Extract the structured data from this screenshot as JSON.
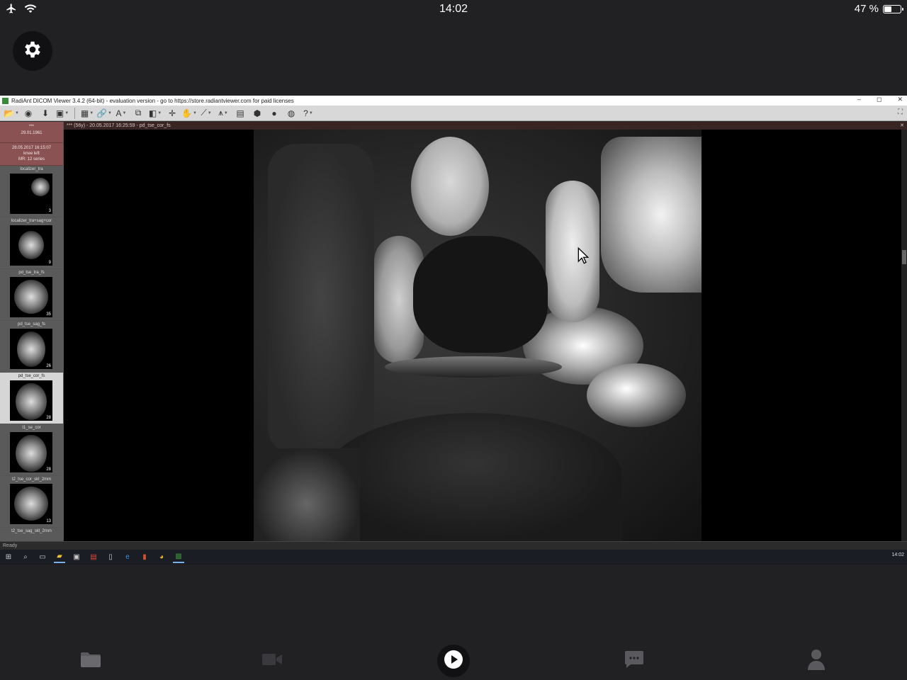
{
  "statusbar": {
    "time": "14:02",
    "battery_text": "47 %",
    "battery_level_percent": 47,
    "icons": [
      "airplane-icon",
      "wifi-icon",
      "battery-icon"
    ]
  },
  "settings": {
    "icon": "gear-icon"
  },
  "dicom": {
    "window_title": "RadiAnt DICOM Viewer 3.4.2 (64-bit) - evaluation version - go to https://store.radiantviewer.com for paid licenses",
    "window_controls": {
      "minimize": "–",
      "maximize": "◻",
      "close": "✕"
    },
    "patient": {
      "name": "***",
      "dob": "29.01.1961"
    },
    "study": {
      "datetime": "28.05.2017 16:15:07",
      "desc": "knee left",
      "summary": "MR: 12 series"
    },
    "series": [
      {
        "name": "localizer_tra",
        "count": "3"
      },
      {
        "name": "localizer_tra+sag+cor",
        "count": "9"
      },
      {
        "name": "pd_tse_tra_fs",
        "count": "35"
      },
      {
        "name": "pd_tse_sag_fs",
        "count": "26"
      },
      {
        "name": "pd_tse_cor_fs",
        "count": "28"
      },
      {
        "name": "t1_se_cor",
        "count": "28"
      },
      {
        "name": "t2_tse_cor_skl_2mm",
        "count": "13"
      },
      {
        "name": "t2_tse_sag_skl_2mm",
        "count": ""
      }
    ],
    "active_series_index": 4,
    "viewer_header": "*** (56y) - 20.05.2017 16:25:59 - pd_tse_cor_fs",
    "status": "Ready",
    "taskbar_clock": "14:02"
  },
  "tabbar": {
    "items": [
      "folder-icon",
      "video-camera-icon",
      "play-icon",
      "chat-icon",
      "person-icon"
    ]
  }
}
